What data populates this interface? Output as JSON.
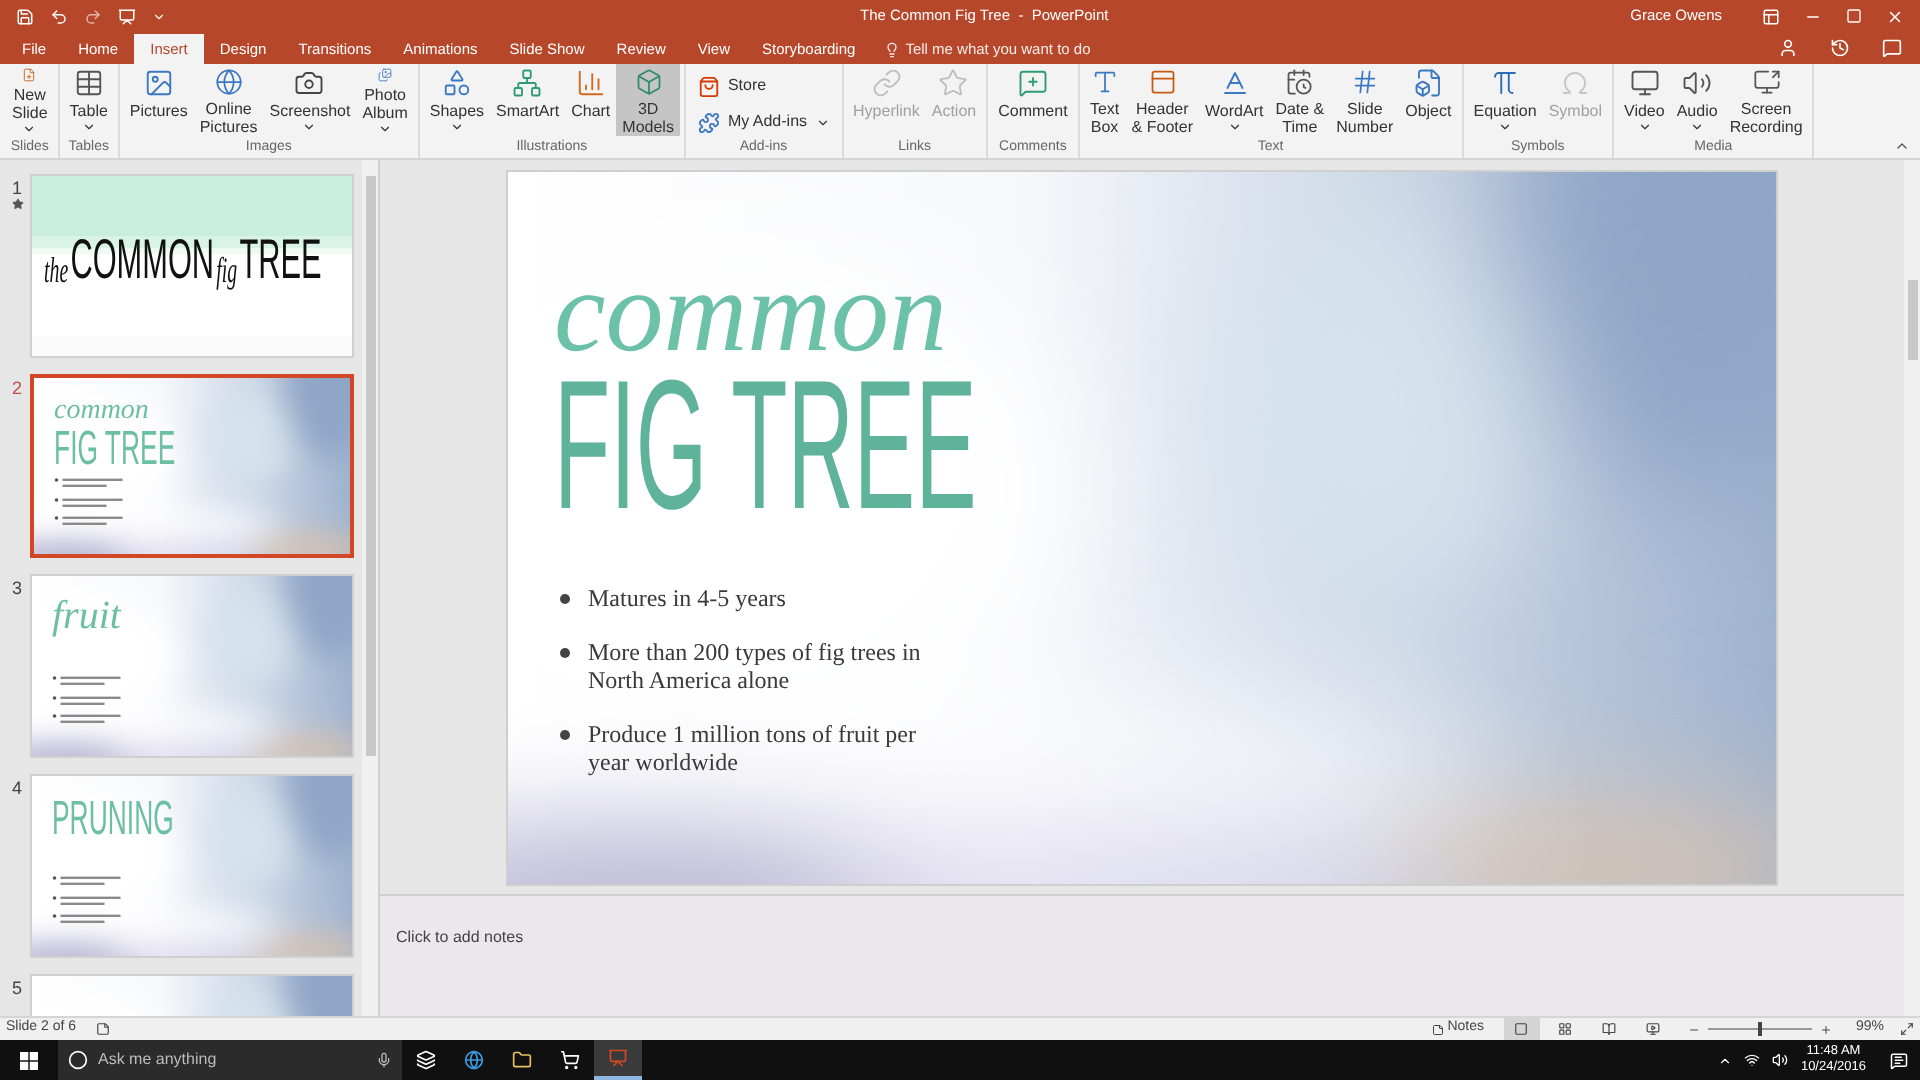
{
  "title_bar": {
    "title": "The Common Fig Tree  -  PowerPoint",
    "user": "Grace Owens"
  },
  "tabs": [
    {
      "label": "File",
      "selected": false
    },
    {
      "label": "Home",
      "selected": false
    },
    {
      "label": "Insert",
      "selected": true
    },
    {
      "label": "Design",
      "selected": false
    },
    {
      "label": "Transitions",
      "selected": false
    },
    {
      "label": "Animations",
      "selected": false
    },
    {
      "label": "Slide Show",
      "selected": false
    },
    {
      "label": "Review",
      "selected": false
    },
    {
      "label": "View",
      "selected": false
    },
    {
      "label": "Storyboarding",
      "selected": false
    }
  ],
  "tell_me": {
    "placeholder": "Tell me what you want to do"
  },
  "ribbon": {
    "groups": [
      {
        "label": "Slides",
        "buttons": [
          {
            "kind": "large",
            "lines": [
              "New",
              "Slide"
            ],
            "dropdown": true,
            "disabled": false,
            "highlighted": false
          }
        ]
      },
      {
        "label": "Tables",
        "buttons": [
          {
            "kind": "large",
            "lines": [
              "Table"
            ],
            "dropdown": true,
            "disabled": false,
            "highlighted": false
          }
        ]
      },
      {
        "label": "Images",
        "buttons": [
          {
            "kind": "large",
            "lines": [
              "Pictures"
            ],
            "dropdown": false,
            "disabled": false,
            "highlighted": false
          },
          {
            "kind": "large",
            "lines": [
              "Online",
              "Pictures"
            ],
            "dropdown": false,
            "disabled": false,
            "highlighted": false
          },
          {
            "kind": "large",
            "lines": [
              "Screenshot"
            ],
            "dropdown": true,
            "disabled": false,
            "highlighted": false
          },
          {
            "kind": "large",
            "lines": [
              "Photo",
              "Album"
            ],
            "dropdown": true,
            "disabled": false,
            "highlighted": false
          }
        ]
      },
      {
        "label": "Illustrations",
        "buttons": [
          {
            "kind": "large",
            "lines": [
              "Shapes"
            ],
            "dropdown": true,
            "disabled": false,
            "highlighted": false
          },
          {
            "kind": "large",
            "lines": [
              "SmartArt"
            ],
            "dropdown": false,
            "disabled": false,
            "highlighted": false
          },
          {
            "kind": "large",
            "lines": [
              "Chart"
            ],
            "dropdown": false,
            "disabled": false,
            "highlighted": false
          },
          {
            "kind": "large",
            "lines": [
              "3D",
              "Models"
            ],
            "dropdown": false,
            "disabled": false,
            "highlighted": true
          }
        ]
      },
      {
        "label": "Add-ins",
        "buttons": [
          {
            "kind": "small",
            "lines": [
              "Store"
            ],
            "dropdown": false,
            "disabled": false,
            "highlighted": false
          },
          {
            "kind": "small",
            "lines": [
              "My Add-ins"
            ],
            "dropdown": true,
            "disabled": false,
            "highlighted": false
          }
        ]
      },
      {
        "label": "Links",
        "buttons": [
          {
            "kind": "large",
            "lines": [
              "Hyperlink"
            ],
            "dropdown": false,
            "disabled": true,
            "highlighted": false
          },
          {
            "kind": "large",
            "lines": [
              "Action"
            ],
            "dropdown": false,
            "disabled": true,
            "highlighted": false
          }
        ]
      },
      {
        "label": "Comments",
        "buttons": [
          {
            "kind": "large",
            "lines": [
              "Comment"
            ],
            "dropdown": false,
            "disabled": false,
            "highlighted": false
          }
        ]
      },
      {
        "label": "Text",
        "buttons": [
          {
            "kind": "large",
            "lines": [
              "Text",
              "Box"
            ],
            "dropdown": false,
            "disabled": false,
            "highlighted": false
          },
          {
            "kind": "large",
            "lines": [
              "Header",
              "& Footer"
            ],
            "dropdown": false,
            "disabled": false,
            "highlighted": false
          },
          {
            "kind": "large",
            "lines": [
              "WordArt"
            ],
            "dropdown": true,
            "disabled": false,
            "highlighted": false
          },
          {
            "kind": "large",
            "lines": [
              "Date &",
              "Time"
            ],
            "dropdown": false,
            "disabled": false,
            "highlighted": false
          },
          {
            "kind": "large",
            "lines": [
              "Slide",
              "Number"
            ],
            "dropdown": false,
            "disabled": false,
            "highlighted": false
          },
          {
            "kind": "large",
            "lines": [
              "Object"
            ],
            "dropdown": false,
            "disabled": false,
            "highlighted": false
          }
        ]
      },
      {
        "label": "Symbols",
        "buttons": [
          {
            "kind": "large",
            "lines": [
              "Equation"
            ],
            "dropdown": true,
            "disabled": false,
            "highlighted": false
          },
          {
            "kind": "large",
            "lines": [
              "Symbol"
            ],
            "dropdown": false,
            "disabled": true,
            "highlighted": false
          }
        ]
      },
      {
        "label": "Media",
        "buttons": [
          {
            "kind": "large",
            "lines": [
              "Video"
            ],
            "dropdown": true,
            "disabled": false,
            "highlighted": false
          },
          {
            "kind": "large",
            "lines": [
              "Audio"
            ],
            "dropdown": true,
            "disabled": false,
            "highlighted": false
          },
          {
            "kind": "large",
            "lines": [
              "Screen",
              "Recording"
            ],
            "dropdown": false,
            "disabled": false,
            "highlighted": false
          }
        ]
      }
    ]
  },
  "slides_panel": {
    "slides": [
      {
        "number": "1",
        "kind": "title",
        "selected": false,
        "animated": true,
        "title_lines": [
          "the",
          "COMMON",
          "fig",
          "TREE"
        ]
      },
      {
        "number": "2",
        "kind": "content",
        "selected": true,
        "animated": false,
        "title_lines": [
          "common",
          "FIG TREE"
        ]
      },
      {
        "number": "3",
        "kind": "content",
        "selected": false,
        "animated": false,
        "title_lines": [
          "fruit"
        ]
      },
      {
        "number": "4",
        "kind": "content",
        "selected": false,
        "animated": false,
        "title_lines": [
          "PRUNING"
        ]
      },
      {
        "number": "5",
        "kind": "content",
        "selected": false,
        "animated": false
      }
    ]
  },
  "slide": {
    "title_top": "common",
    "title_bottom": "FIG TREE",
    "bullets": [
      "Matures in 4-5 years",
      "More than 200 types of fig trees in North America alone",
      "Produce 1 million tons of fruit per year worldwide"
    ]
  },
  "notes": {
    "placeholder": "Click to add notes"
  },
  "status_bar": {
    "slide_info": "Slide 2 of 6",
    "notes": "Notes",
    "views": [
      {
        "selected": true
      },
      {
        "selected": false
      },
      {
        "selected": false
      },
      {
        "selected": false
      }
    ],
    "zoom_slider": {
      "level": 0.5
    },
    "zoom": "99%"
  },
  "taskbar": {
    "search": {
      "placeholder": "Ask me anything"
    },
    "apps": [
      {
        "selected": false
      },
      {
        "selected": false
      },
      {
        "selected": false
      },
      {
        "selected": false
      },
      {
        "selected": true
      }
    ],
    "time": "11:48 AM",
    "date": "10/24/2016"
  }
}
